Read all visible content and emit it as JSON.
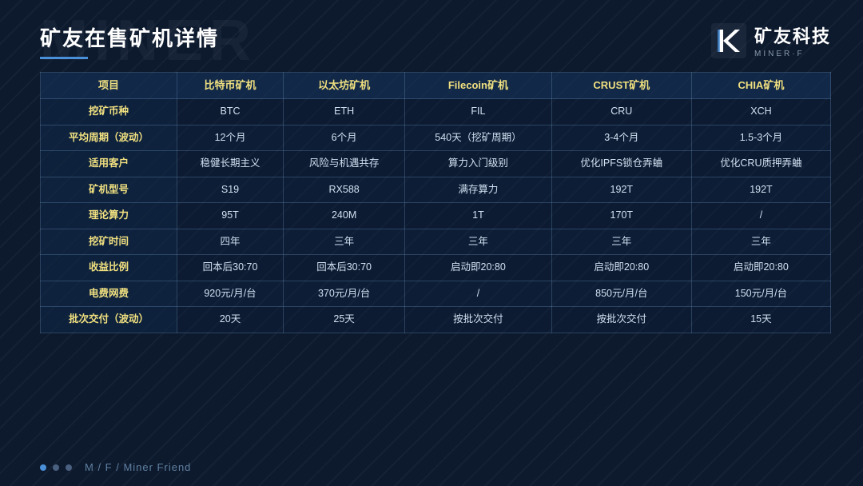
{
  "page": {
    "title": "矿友在售矿机详情",
    "bg_text": "MINER",
    "footer_text": "M / F /  Miner Friend"
  },
  "logo": {
    "main": "矿友科技",
    "sub": "MINER·F"
  },
  "table": {
    "headers": [
      "项目",
      "比特币矿机",
      "以太坊矿机",
      "Filecoin矿机",
      "CRUST矿机",
      "CHIA矿机"
    ],
    "rows": [
      [
        "挖矿币种",
        "BTC",
        "ETH",
        "FIL",
        "CRU",
        "XCH"
      ],
      [
        "平均周期（波动）",
        "12个月",
        "6个月",
        "540天（挖矿周期）",
        "3-4个月",
        "1.5-3个月"
      ],
      [
        "适用客户",
        "稳健长期主义",
        "风险与机遇共存",
        "算力入门级别",
        "优化IPFS锁仓弄蛐",
        "优化CRU质押弄蛐"
      ],
      [
        "矿机型号",
        "S19",
        "RX588",
        "满存算力",
        "192T",
        "192T"
      ],
      [
        "理论算力",
        "95T",
        "240M",
        "1T",
        "170T",
        "/"
      ],
      [
        "挖矿时间",
        "四年",
        "三年",
        "三年",
        "三年",
        "三年"
      ],
      [
        "收益比例",
        "回本后30:70",
        "回本后30:70",
        "启动即20:80",
        "启动即20:80",
        "启动即20:80"
      ],
      [
        "电费网费",
        "920元/月/台",
        "370元/月/台",
        "/",
        "850元/月/台",
        "150元/月/台"
      ],
      [
        "批次交付（波动）",
        "20天",
        "25天",
        "按批次交付",
        "按批次交付",
        "15天"
      ]
    ]
  },
  "footer": {
    "dots": [
      {
        "active": true
      },
      {
        "active": false
      },
      {
        "active": false
      }
    ],
    "text": "M / F /  Miner Friend"
  }
}
